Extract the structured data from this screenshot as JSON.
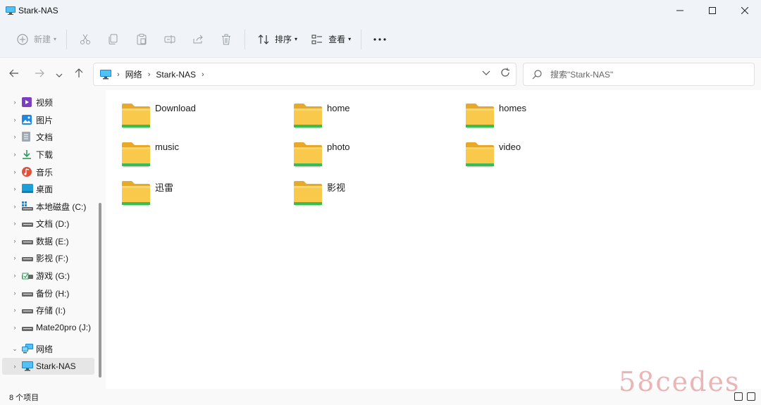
{
  "window": {
    "title": "Stark-NAS"
  },
  "toolbar": {
    "new_label": "新建",
    "sort_label": "排序",
    "view_label": "查看"
  },
  "address": {
    "crumbs": [
      "网络",
      "Stark-NAS"
    ]
  },
  "search": {
    "placeholder": "搜索\"Stark-NAS\""
  },
  "sidebar": {
    "items": [
      {
        "label": "视频"
      },
      {
        "label": "图片"
      },
      {
        "label": "文档"
      },
      {
        "label": "下载"
      },
      {
        "label": "音乐"
      },
      {
        "label": "桌面"
      },
      {
        "label": "本地磁盘 (C:)"
      },
      {
        "label": "文档 (D:)"
      },
      {
        "label": "数据 (E:)"
      },
      {
        "label": "影视 (F:)"
      },
      {
        "label": "游戏 (G:)"
      },
      {
        "label": "备份 (H:)"
      },
      {
        "label": "存储 (I:)"
      },
      {
        "label": "Mate20pro (J:)"
      },
      {
        "label": "网络"
      },
      {
        "label": "Stark-NAS"
      }
    ]
  },
  "folders": [
    {
      "name": "Download"
    },
    {
      "name": "home"
    },
    {
      "name": "homes"
    },
    {
      "name": "music"
    },
    {
      "name": "photo"
    },
    {
      "name": "video"
    },
    {
      "name": "迅雷"
    },
    {
      "name": "影视"
    }
  ],
  "status": {
    "item_count": "8 个项目"
  },
  "watermark": {
    "text": "58cedes"
  },
  "colors": {
    "folder": "#f5c542",
    "folder_dark": "#e8a92b",
    "share_bar": "#3cba54",
    "accent": "#0067c0"
  }
}
